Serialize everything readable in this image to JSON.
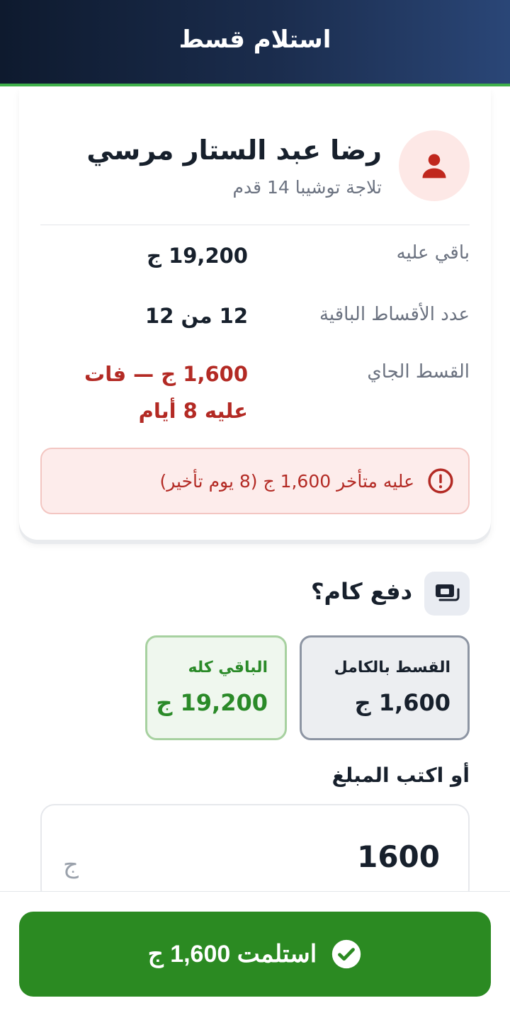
{
  "header": {
    "title": "استلام قسط"
  },
  "customer": {
    "name": "رضا عبد الستار مرسي",
    "product": "تلاجة توشيبا 14 قدم"
  },
  "details": [
    {
      "label": "باقي عليه",
      "value": "19,200 ج"
    },
    {
      "label": "عدد الأقساط الباقية",
      "value": "12 من 12"
    },
    {
      "label": "القسط الجاي",
      "value": "1,600 ج — فات عليه 8 أيام"
    }
  ],
  "alert": {
    "text": "عليه متأخر 1,600 ج (8 يوم تأخير)"
  },
  "payment": {
    "title": "دفع كام؟",
    "options": [
      {
        "label": "القسط بالكامل",
        "value": "1,600 ج",
        "selected": true
      },
      {
        "label": "الباقي كله",
        "value": "19,200 ج",
        "selected": false
      }
    ],
    "custom_label": "أو اكتب المبلغ",
    "amount_value": "1600",
    "currency": "ج"
  },
  "confirm": {
    "label": "استلمت 1,600 ج"
  },
  "colors": {
    "primary_green": "#2b8a22",
    "danger_red": "#b32a24",
    "header_dark": "#0e1a2e"
  }
}
